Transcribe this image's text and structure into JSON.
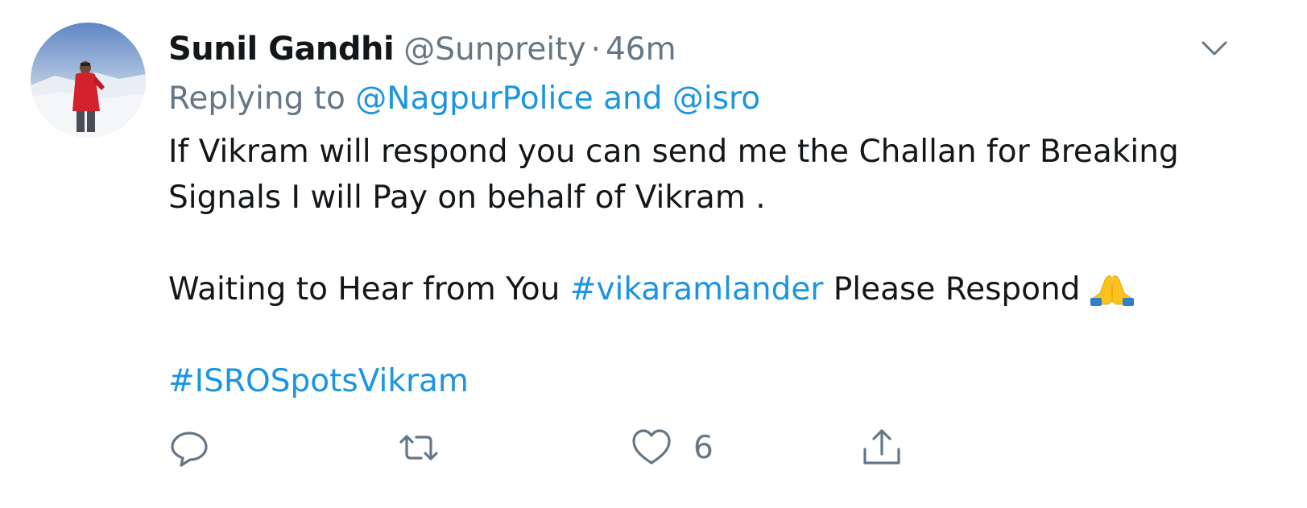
{
  "tweet": {
    "display_name": "Sunil Gandhi",
    "handle": "@Sunpreity",
    "separator": "·",
    "time": "46m",
    "replying_prefix": "Replying to",
    "replying_mention_1": "@NagpurPolice",
    "replying_and": "and",
    "replying_mention_2": "@isro",
    "line_1": "If Vikram will respond you can send me the Challan for Breaking Signals I will Pay on behalf of Vikram .",
    "line_2_before": "Waiting to Hear from You",
    "hashtag_1": "#vikaramlander",
    "line_2_after": "Please Respond",
    "emoji": "folded-hands",
    "hashtag_2": "#ISROSpotsVikram"
  },
  "actions": {
    "reply_icon": "reply-icon",
    "retweet_icon": "retweet-icon",
    "like_icon": "heart-icon",
    "like_count": "6",
    "share_icon": "share-icon"
  },
  "colors": {
    "text": "#14171a",
    "muted": "#657786",
    "link": "#1b95e0"
  }
}
